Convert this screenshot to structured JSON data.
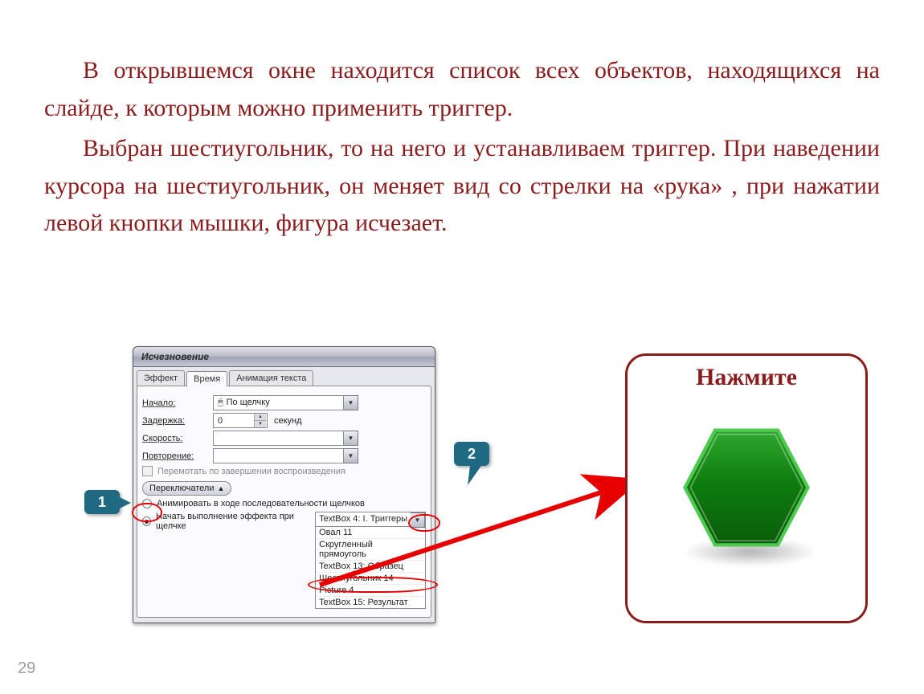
{
  "page_number": "29",
  "paragraphs": [
    "В открывшемся окне находится список всех объектов, находящихся на слайде, к которым можно применить триггер.",
    "Выбран шестиугольник, то на него и устанавливаем триггер. При наведении курсора на шестиугольник, он меняет вид со стрелки на «рука» , при нажатии левой кнопки мышки, фигура исчезает."
  ],
  "dialog": {
    "title": "Исчезновение",
    "tabs": [
      "Эффект",
      "Время",
      "Анимация текста"
    ],
    "active_tab_index": 1,
    "labels": {
      "start": "Начало:",
      "delay": "Задержка:",
      "speed": "Скорость:",
      "repeat": "Повторение:",
      "seconds": "секунд",
      "rewind_checkbox": "Перемотать по завершении воспроизведения",
      "toggles_button": "Переключатели",
      "radio_seq": "Анимировать в ходе последовательности щелчков",
      "radio_click": "Начать выполнение эффекта при щелчке"
    },
    "values": {
      "start": "По щелчку",
      "delay": "0",
      "trigger_selected": "TextBox 4: I. Триггеры"
    },
    "dropdown_items": [
      "Овал 11",
      "Скругленный прямоуголь",
      "TextBox 13: Образец",
      "Шестиугольник 14",
      "Picture 4",
      "TextBox 15: Результат"
    ]
  },
  "callouts": {
    "one": "1",
    "two": "2"
  },
  "click_box": {
    "caption": "Нажмите"
  }
}
